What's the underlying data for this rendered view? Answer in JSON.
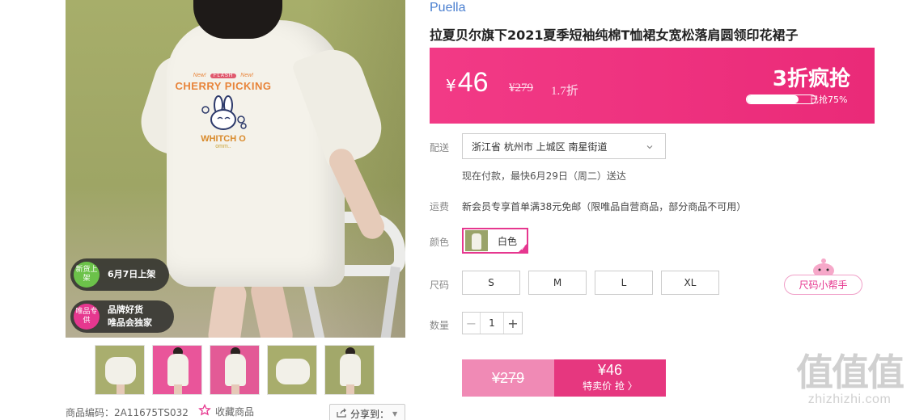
{
  "gallery": {
    "print": {
      "new_left": "New!",
      "flash": "FLASH",
      "new_right": "New!",
      "cherry": "CHERRY PICKING",
      "whitch": "WHITCH O",
      "omm": "omm.."
    },
    "badge_new": {
      "circle": "新货上架",
      "text": "6月7日上架"
    },
    "badge_brand": {
      "circle": "唯品专供",
      "line1": "品牌好货",
      "line2": "唯品会独家"
    },
    "zoom_icon": "magnifier-icon"
  },
  "meta": {
    "sku_label": "商品编码：",
    "sku": "2A11675TS032",
    "favorite": "收藏商品",
    "share": "分享到："
  },
  "product": {
    "brand": "Puella",
    "title": "拉夏贝尔旗下2021夏季短袖纯棉T恤裙女宽松落肩圆领印花裙子"
  },
  "price_bar": {
    "currency": "¥",
    "price": "46",
    "original": "¥279",
    "discount": "1.7折",
    "flash_label": "3折疯抢",
    "sold_text": "已抢75%",
    "sold_fraction": 0.75
  },
  "delivery": {
    "label": "配送",
    "address": "浙江省 杭州市 上城区 南星街道",
    "eta": "现在付款，最快6月29日（周二）送达"
  },
  "freight": {
    "label": "运费",
    "text": "新会员专享首单满38元免邮（限唯品自营商品，部分商品不可用）"
  },
  "color": {
    "label": "颜色",
    "selected": "白色"
  },
  "size": {
    "label": "尺码",
    "options": [
      "S",
      "M",
      "L",
      "XL"
    ],
    "helper": "尺码小帮手"
  },
  "quantity": {
    "label": "数量",
    "value": "1"
  },
  "buy": {
    "original": "¥279",
    "price": "¥46",
    "label": "特卖价 抢 〉"
  },
  "watermark": {
    "big": "值值值",
    "small": "zhizhizhi.com"
  },
  "colors": {
    "accent": "#e6378f",
    "price_bar": "#f23a86",
    "brand_link": "#4a7fd0"
  }
}
